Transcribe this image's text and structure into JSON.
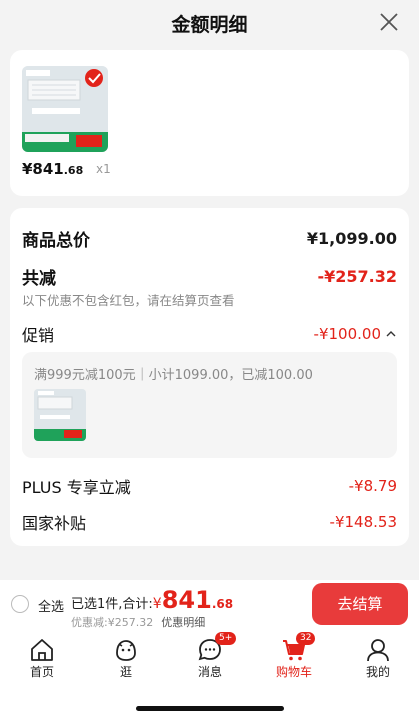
{
  "header": {
    "title": "金额明细"
  },
  "product": {
    "price_main": "¥841",
    "price_small": ".68",
    "qty": "x1"
  },
  "summary": {
    "goods_total_label": "商品总价",
    "goods_total_value": "¥1,099.00",
    "reduce_label": "共减",
    "reduce_value": "-¥257.32",
    "note": "以下优惠不包含红包，请在结算页查看",
    "promo_label": "促销",
    "promo_value": "-¥100.00",
    "promo_detail": "满999元减100元｜小计1099.00，已减100.00",
    "plus_label": "PLUS 专享立减",
    "plus_value": "-¥8.79",
    "subsidy_label": "国家补贴",
    "subsidy_value": "-¥148.53"
  },
  "bottom_bar": {
    "select_all": "全选",
    "selected_prefix": "已选1件,合计:",
    "currency": "¥",
    "total_main": "841",
    "total_small": ".68",
    "discount_text": "优惠减:¥257.32",
    "detail_link": "优惠明细",
    "checkout_label": "去结算"
  },
  "tabs": [
    {
      "label": "首页",
      "icon": "home-icon"
    },
    {
      "label": "逛",
      "icon": "face-icon"
    },
    {
      "label": "消息",
      "icon": "message-icon",
      "badge": "5+"
    },
    {
      "label": "购物车",
      "icon": "cart-icon",
      "badge": "32",
      "active": true
    },
    {
      "label": "我的",
      "icon": "user-icon"
    }
  ],
  "colors": {
    "accent": "#e2231a",
    "checkout_bg": "#e83b3b"
  }
}
